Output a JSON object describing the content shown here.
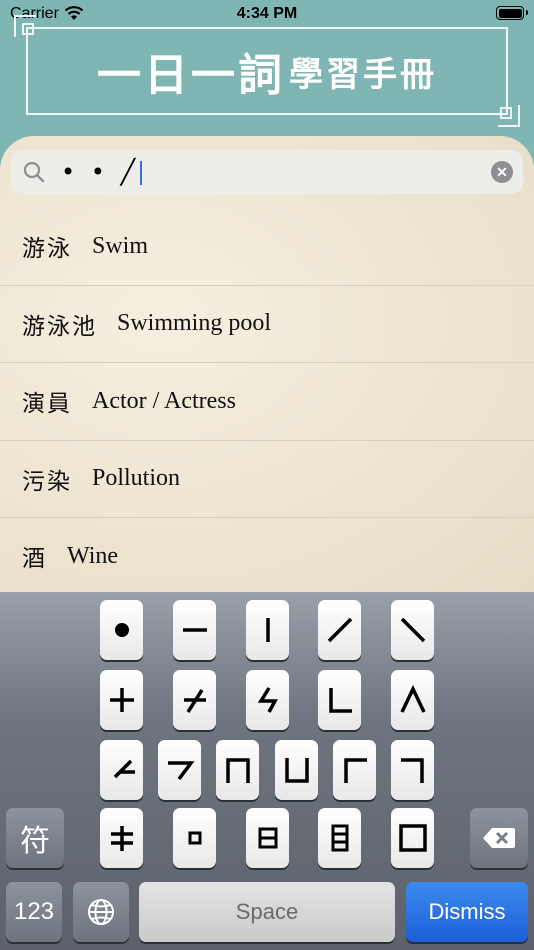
{
  "status_bar": {
    "carrier": "Carrier",
    "time": "4:34 PM"
  },
  "banner": {
    "title_large": "一日一詞",
    "title_small": "學習手冊"
  },
  "search": {
    "query": "• • ╱"
  },
  "results": [
    {
      "zh": "游泳",
      "en": "Swim"
    },
    {
      "zh": "游泳池",
      "en": "Swimming pool"
    },
    {
      "zh": "演員",
      "en": "Actor / Actress"
    },
    {
      "zh": "污染",
      "en": "Pollution"
    },
    {
      "zh": "酒",
      "en": "Wine"
    }
  ],
  "keyboard": {
    "symbol_key": "符",
    "numbers_key": "123",
    "space_key": "Space",
    "dismiss_key": "Dismiss",
    "stroke_keys": [
      "dot",
      "horizontal",
      "vertical",
      "slash",
      "backslash",
      "cross",
      "slash-cross",
      "zigzag",
      "l-bend",
      "caret",
      "left-hook",
      "right-hook",
      "n-shape",
      "u-shape",
      "corner-tl",
      "corner-tr",
      "double-cross",
      "square-dot",
      "box-bar",
      "tall-box",
      "square"
    ]
  }
}
